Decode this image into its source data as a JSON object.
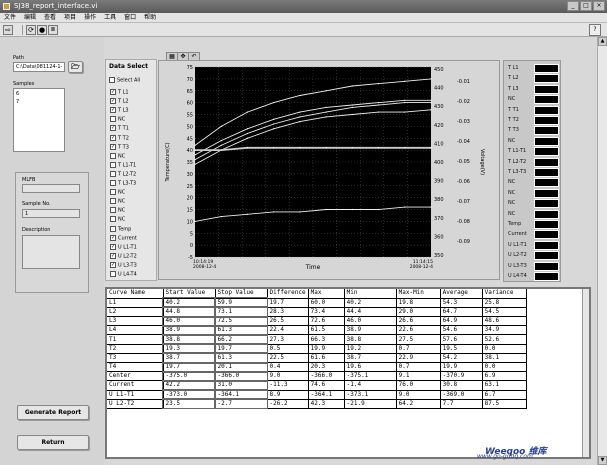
{
  "window": {
    "title": "SJ38_report_interface.vi",
    "buttons": [
      "_",
      "□",
      "×"
    ]
  },
  "menu": [
    "文件",
    "编辑",
    "查看",
    "项目",
    "操作",
    "工具",
    "窗口",
    "帮助"
  ],
  "toolbar": {
    "run": "⇨",
    "run_cont": "⟳",
    "stop": "●",
    "pause": "II",
    "help": "?"
  },
  "left": {
    "path_label": "Path",
    "path_value": "C:\\Data\\081124-1-",
    "samples_label": "Samples",
    "samples": [
      "6",
      "7"
    ],
    "mlfb_label": "MLFB",
    "mlfb_value": "",
    "sample_no_label": "Sample No.",
    "sample_no_value": "1",
    "description_label": "Description",
    "description_value": "",
    "generate_btn": "Generate Report",
    "return_btn": "Return"
  },
  "data_select": {
    "title": "Data Select",
    "select_all": "Select All",
    "items": [
      {
        "label": "T L1",
        "checked": true
      },
      {
        "label": "T L2",
        "checked": true
      },
      {
        "label": "T L3",
        "checked": true
      },
      {
        "label": "NC",
        "checked": false
      },
      {
        "label": "T T1",
        "checked": true
      },
      {
        "label": "T T2",
        "checked": true
      },
      {
        "label": "T T3",
        "checked": true
      },
      {
        "label": "NC",
        "checked": false
      },
      {
        "label": "T L1-T1",
        "checked": false
      },
      {
        "label": "T L2-T2",
        "checked": false
      },
      {
        "label": "T L3-T3",
        "checked": false
      },
      {
        "label": "NC",
        "checked": false
      },
      {
        "label": "NC",
        "checked": false
      },
      {
        "label": "NC",
        "checked": false
      },
      {
        "label": "NC",
        "checked": false
      },
      {
        "label": "Temp",
        "checked": false
      },
      {
        "label": "Current",
        "checked": true
      },
      {
        "label": "U L1-T1",
        "checked": true
      },
      {
        "label": "U L2-T2",
        "checked": true
      },
      {
        "label": "U L3-T3",
        "checked": true
      },
      {
        "label": "U L4-T4",
        "checked": false
      }
    ]
  },
  "graph_tabs": [
    "▦",
    "✥",
    "↶"
  ],
  "chart_data": {
    "type": "line",
    "xlabel": "Time",
    "ylabel": "Temperature(C)",
    "y2label": "Voltage(V)",
    "x_start": "10:14:19\n2008-12-4",
    "x_end": "11:14:15\n2008-12-4",
    "ylim": [
      -5,
      75
    ],
    "yticks": [
      -5,
      0,
      5,
      10,
      15,
      20,
      25,
      30,
      35,
      40,
      45,
      50,
      55,
      60,
      65,
      70,
      75
    ],
    "y2ticks_left": [
      "450",
      "440",
      "430",
      "420",
      "410",
      "400",
      "390",
      "380",
      "370",
      "360",
      "350"
    ],
    "y2ticks_right": [
      "-0.01",
      "-0.02",
      "-0.03",
      "-0.04",
      "-0.05",
      "-0.06",
      "-0.07",
      "-0.08",
      "-0.09"
    ],
    "grid": true,
    "series": [
      {
        "values": [
          42,
          50,
          56,
          60,
          63,
          65,
          67,
          68,
          69,
          70
        ]
      },
      {
        "values": [
          38,
          44,
          49,
          53,
          56,
          58,
          59,
          60,
          61,
          61
        ]
      },
      {
        "values": [
          36,
          42,
          47,
          51,
          54,
          56,
          58,
          59,
          60,
          60
        ]
      },
      {
        "values": [
          34,
          40,
          45,
          49,
          52,
          54,
          55,
          56,
          56,
          57
        ]
      },
      {
        "values": [
          40,
          40,
          41,
          41,
          41,
          41,
          41,
          41,
          41,
          41
        ]
      },
      {
        "values": [
          10,
          12,
          13,
          14,
          14,
          15,
          15,
          15,
          16,
          16
        ]
      }
    ]
  },
  "legend": [
    "T L1",
    "T L2",
    "T L3",
    "NC",
    "T T1",
    "T T2",
    "T T3",
    "NC",
    "T L1-T1",
    "T L2-T2",
    "T L3-T3",
    "NC",
    "NC",
    "NC",
    "NC",
    "Temp",
    "Current",
    "U L1-T1",
    "U L2-T2",
    "U L3-T3",
    "U L4-T4"
  ],
  "table": {
    "header": [
      "Curve Name",
      "Start Value",
      "Stop Value",
      "Difference",
      "Max",
      "Min",
      "Max-Min",
      "Average",
      "Variance"
    ],
    "rows": [
      [
        "L1",
        "40.2",
        "59.9",
        "19.7",
        "60.0",
        "40.2",
        "19.8",
        "54.3",
        "25.8"
      ],
      [
        "L2",
        "44.8",
        "73.1",
        "28.3",
        "73.4",
        "44.4",
        "29.0",
        "64.7",
        "54.5"
      ],
      [
        "L3",
        "46.0",
        "72.5",
        "26.5",
        "72.6",
        "46.0",
        "26.6",
        "64.9",
        "48.6"
      ],
      [
        "L4",
        "38.9",
        "61.3",
        "22.4",
        "61.5",
        "38.9",
        "22.6",
        "54.6",
        "34.9"
      ],
      [
        "T1",
        "38.8",
        "66.2",
        "27.3",
        "66.3",
        "38.8",
        "27.5",
        "57.6",
        "52.6"
      ],
      [
        "T2",
        "19.3",
        "19.7",
        "0.5",
        "19.9",
        "19.2",
        "0.7",
        "19.5",
        "0.0"
      ],
      [
        "T3",
        "38.7",
        "61.3",
        "22.5",
        "61.6",
        "38.7",
        "22.9",
        "54.2",
        "38.1"
      ],
      [
        "T4",
        "19.7",
        "20.1",
        "0.4",
        "20.3",
        "19.6",
        "0.7",
        "19.9",
        "0.0"
      ],
      [
        "Center",
        "-375.0",
        "-366.0",
        "9.0",
        "-366.0",
        "-375.1",
        "9.1",
        "-370.9",
        "6.9"
      ],
      [
        "Current",
        "42.2",
        "31.0",
        "-11.3",
        "74.6",
        "-1.4",
        "76.0",
        "30.8",
        "63.1"
      ],
      [
        "U L1-T1",
        "-373.0",
        "-364.1",
        "8.9",
        "-364.1",
        "-373.1",
        "9.0",
        "-369.0",
        "6.7"
      ],
      [
        "U L2-T2",
        "23.5",
        "-2.7",
        "-26.2",
        "42.3",
        "-21.9",
        "64.2",
        "7.7",
        "87.5"
      ]
    ]
  },
  "watermark": {
    "main": "Weeqoo 维库",
    "sub": "www.go-gddq.com"
  }
}
